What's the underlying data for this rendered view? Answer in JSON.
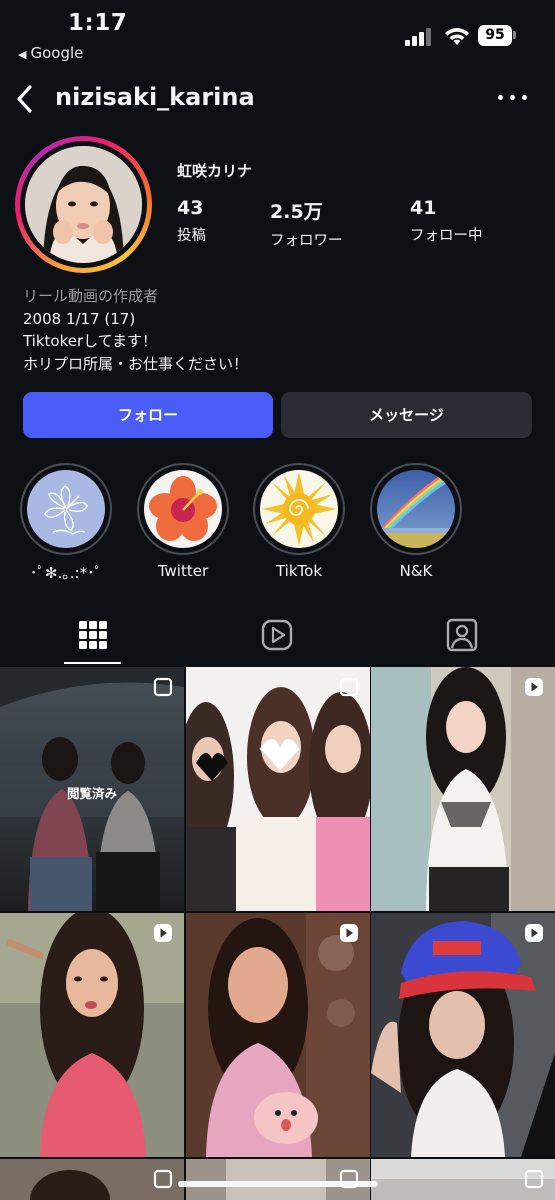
{
  "status_bar": {
    "time": "1:17",
    "back_app": "Google",
    "battery": "95"
  },
  "header": {
    "username": "nizisaki_karina"
  },
  "profile": {
    "display_name": "虹咲カリナ",
    "stats": [
      {
        "value": "43",
        "label": "投稿"
      },
      {
        "value": "2.5万",
        "label": "フォロワー"
      },
      {
        "value": "41",
        "label": "フォロー中"
      }
    ],
    "bio": {
      "category": "リール動画の作成者",
      "lines": [
        "2008 1/17 (17)",
        "Tiktokerしてます！",
        "ホリプロ所属・お仕事ください！"
      ]
    }
  },
  "actions": {
    "follow": "フォロー",
    "message": "メッセージ"
  },
  "highlights": [
    {
      "label": "･ﾟ✻.｡.:*･ﾟ",
      "icon": "hibiscus-sketch-icon"
    },
    {
      "label": "Twitter",
      "icon": "hibiscus-flower-icon"
    },
    {
      "label": "TikTok",
      "icon": "sun-icon"
    },
    {
      "label": "N&K",
      "icon": "rainbow-icon"
    }
  ],
  "tabs": [
    "grid-icon",
    "reels-icon",
    "tagged-icon"
  ],
  "grid": {
    "seen_label": "閲覧済み",
    "posts": [
      {
        "type": "multi",
        "seen": true
      },
      {
        "type": "multi",
        "seen": false
      },
      {
        "type": "reel",
        "seen": false
      },
      {
        "type": "reel",
        "seen": false
      },
      {
        "type": "reel",
        "seen": false
      },
      {
        "type": "reel",
        "seen": false
      }
    ]
  },
  "colors": {
    "background": "#0c0f14",
    "follow_button": "#4a5df9",
    "message_button": "#2a2d33"
  }
}
